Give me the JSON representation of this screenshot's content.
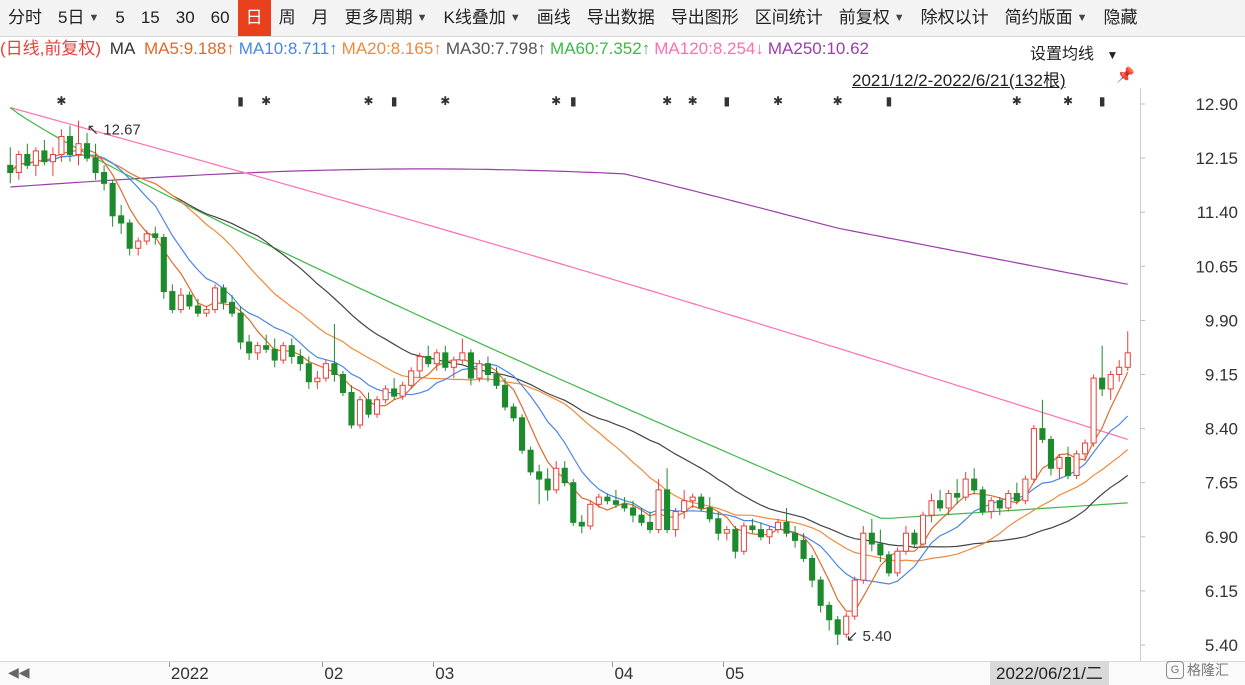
{
  "toolbar": {
    "items": [
      {
        "label": "分时",
        "active": false,
        "dropdown": false
      },
      {
        "label": "5日",
        "active": false,
        "dropdown": true
      },
      {
        "label": "5",
        "active": false,
        "dropdown": false
      },
      {
        "label": "15",
        "active": false,
        "dropdown": false
      },
      {
        "label": "30",
        "active": false,
        "dropdown": false
      },
      {
        "label": "60",
        "active": false,
        "dropdown": false
      },
      {
        "label": "日",
        "active": true,
        "dropdown": false
      },
      {
        "label": "周",
        "active": false,
        "dropdown": false
      },
      {
        "label": "月",
        "active": false,
        "dropdown": false
      },
      {
        "label": "更多周期",
        "active": false,
        "dropdown": true
      },
      {
        "label": "K线叠加",
        "active": false,
        "dropdown": true
      },
      {
        "label": "画线",
        "active": false,
        "dropdown": false
      },
      {
        "label": "导出数据",
        "active": false,
        "dropdown": false
      },
      {
        "label": "导出图形",
        "active": false,
        "dropdown": false
      },
      {
        "label": "区间统计",
        "active": false,
        "dropdown": false
      },
      {
        "label": "前复权",
        "active": false,
        "dropdown": true
      },
      {
        "label": "除权以计",
        "active": false,
        "dropdown": false
      },
      {
        "label": "简约版面",
        "active": false,
        "dropdown": true
      },
      {
        "label": "隐藏",
        "active": false,
        "dropdown": false
      }
    ]
  },
  "ma_legend": {
    "prefix": "(日线,前复权)",
    "ma_label": "MA",
    "items": [
      {
        "text": "MA5:9.188↑",
        "color": "#e06a2c"
      },
      {
        "text": "MA10:8.711↑",
        "color": "#4a86e8"
      },
      {
        "text": "MA20:8.165↑",
        "color": "#f08a3c"
      },
      {
        "text": "MA30:7.798↑",
        "color": "#555555"
      },
      {
        "text": "MA60:7.352↑",
        "color": "#3cb84a"
      },
      {
        "text": "MA120:8.254↓",
        "color": "#ff6eb4"
      },
      {
        "text": "MA250:10.62",
        "color": "#9b3fa8"
      }
    ],
    "settings_label": "设置均线",
    "range_label": "2021/12/2-2022/6/21(132根)"
  },
  "colors": {
    "up": "#e8403a",
    "down": "#1e8a2e",
    "ma5": "#e06a2c",
    "ma10": "#4a86e8",
    "ma20": "#f08a3c",
    "ma30": "#444444",
    "ma60": "#3cb84a",
    "ma120": "#ff6eb4",
    "ma250": "#9b3fa8"
  },
  "chart_data": {
    "type": "candlestick",
    "y_ticks": [
      "12.90",
      "12.15",
      "11.40",
      "10.65",
      "9.90",
      "9.15",
      "8.40",
      "7.65",
      "6.90",
      "6.15",
      "5.40"
    ],
    "ylim": [
      5.4,
      12.9
    ],
    "x_labels": [
      "2022",
      "02",
      "03",
      "04",
      "05"
    ],
    "annotations": [
      {
        "text": "12.67",
        "type": "high"
      },
      {
        "text": "5.40",
        "type": "low"
      }
    ],
    "current_date_label": "2022/06/21/二",
    "candles": [
      [
        12.05,
        12.3,
        11.8,
        11.95
      ],
      [
        11.95,
        12.25,
        11.85,
        12.2
      ],
      [
        12.2,
        12.35,
        12.0,
        12.05
      ],
      [
        12.05,
        12.3,
        11.9,
        12.25
      ],
      [
        12.25,
        12.4,
        12.05,
        12.1
      ],
      [
        12.1,
        12.3,
        11.9,
        12.2
      ],
      [
        12.2,
        12.55,
        12.1,
        12.45
      ],
      [
        12.45,
        12.6,
        12.1,
        12.2
      ],
      [
        12.2,
        12.67,
        12.05,
        12.35
      ],
      [
        12.35,
        12.5,
        12.1,
        12.15
      ],
      [
        12.15,
        12.35,
        11.85,
        11.95
      ],
      [
        11.95,
        12.05,
        11.7,
        11.8
      ],
      [
        11.8,
        11.85,
        11.2,
        11.35
      ],
      [
        11.35,
        11.5,
        11.1,
        11.25
      ],
      [
        11.25,
        11.3,
        10.8,
        10.9
      ],
      [
        10.9,
        11.05,
        10.8,
        11.0
      ],
      [
        11.0,
        11.15,
        10.95,
        11.1
      ],
      [
        11.1,
        11.2,
        10.95,
        11.05
      ],
      [
        11.05,
        11.1,
        10.2,
        10.3
      ],
      [
        10.3,
        10.4,
        10.0,
        10.05
      ],
      [
        10.05,
        10.35,
        10.0,
        10.25
      ],
      [
        10.25,
        10.3,
        10.05,
        10.1
      ],
      [
        10.1,
        10.2,
        9.95,
        10.0
      ],
      [
        10.0,
        10.1,
        9.95,
        10.05
      ],
      [
        10.05,
        10.4,
        10.0,
        10.35
      ],
      [
        10.35,
        10.4,
        10.05,
        10.15
      ],
      [
        10.15,
        10.25,
        9.95,
        10.0
      ],
      [
        10.0,
        10.1,
        9.5,
        9.6
      ],
      [
        9.6,
        9.7,
        9.35,
        9.45
      ],
      [
        9.45,
        9.6,
        9.35,
        9.55
      ],
      [
        9.55,
        9.7,
        9.45,
        9.5
      ],
      [
        9.5,
        9.65,
        9.25,
        9.35
      ],
      [
        9.35,
        9.6,
        9.3,
        9.55
      ],
      [
        9.55,
        9.65,
        9.3,
        9.4
      ],
      [
        9.4,
        9.5,
        9.2,
        9.3
      ],
      [
        9.3,
        9.4,
        8.95,
        9.05
      ],
      [
        9.05,
        9.2,
        8.95,
        9.1
      ],
      [
        9.1,
        9.35,
        9.05,
        9.3
      ],
      [
        9.3,
        9.85,
        9.05,
        9.15
      ],
      [
        9.15,
        9.2,
        8.85,
        8.9
      ],
      [
        8.9,
        9.0,
        8.4,
        8.45
      ],
      [
        8.45,
        8.85,
        8.4,
        8.8
      ],
      [
        8.8,
        8.9,
        8.55,
        8.6
      ],
      [
        8.6,
        8.85,
        8.55,
        8.8
      ],
      [
        8.8,
        9.0,
        8.75,
        8.95
      ],
      [
        8.95,
        9.1,
        8.8,
        8.85
      ],
      [
        8.85,
        9.05,
        8.8,
        9.0
      ],
      [
        9.0,
        9.25,
        8.95,
        9.2
      ],
      [
        9.2,
        9.45,
        9.1,
        9.4
      ],
      [
        9.4,
        9.55,
        9.25,
        9.3
      ],
      [
        9.3,
        9.5,
        9.2,
        9.45
      ],
      [
        9.45,
        9.55,
        9.2,
        9.25
      ],
      [
        9.25,
        9.4,
        9.1,
        9.35
      ],
      [
        9.35,
        9.65,
        9.3,
        9.45
      ],
      [
        9.45,
        9.5,
        9.0,
        9.1
      ],
      [
        9.1,
        9.35,
        9.05,
        9.3
      ],
      [
        9.3,
        9.4,
        9.05,
        9.15
      ],
      [
        9.15,
        9.25,
        8.95,
        9.0
      ],
      [
        9.0,
        9.1,
        8.65,
        8.7
      ],
      [
        8.7,
        8.75,
        8.5,
        8.55
      ],
      [
        8.55,
        8.6,
        8.05,
        8.1
      ],
      [
        8.1,
        8.15,
        7.75,
        7.8
      ],
      [
        7.8,
        7.9,
        7.35,
        7.7
      ],
      [
        7.7,
        7.85,
        7.4,
        7.55
      ],
      [
        7.55,
        7.95,
        7.5,
        7.85
      ],
      [
        7.85,
        7.95,
        7.6,
        7.65
      ],
      [
        7.65,
        7.7,
        7.05,
        7.1
      ],
      [
        7.1,
        7.2,
        6.95,
        7.05
      ],
      [
        7.05,
        7.4,
        7.0,
        7.35
      ],
      [
        7.35,
        7.5,
        7.3,
        7.45
      ],
      [
        7.45,
        7.5,
        7.35,
        7.4
      ],
      [
        7.4,
        7.55,
        7.3,
        7.35
      ],
      [
        7.35,
        7.45,
        7.25,
        7.3
      ],
      [
        7.3,
        7.4,
        7.1,
        7.2
      ],
      [
        7.2,
        7.3,
        7.05,
        7.1
      ],
      [
        7.1,
        7.25,
        6.95,
        7.0
      ],
      [
        7.0,
        7.7,
        6.95,
        7.55
      ],
      [
        7.55,
        7.85,
        6.95,
        7.0
      ],
      [
        7.0,
        7.3,
        6.9,
        7.25
      ],
      [
        7.25,
        7.55,
        7.15,
        7.4
      ],
      [
        7.4,
        7.5,
        7.3,
        7.45
      ],
      [
        7.45,
        7.5,
        7.25,
        7.3
      ],
      [
        7.3,
        7.45,
        7.1,
        7.15
      ],
      [
        7.15,
        7.25,
        6.85,
        6.95
      ],
      [
        6.95,
        7.05,
        6.85,
        7.0
      ],
      [
        7.0,
        7.05,
        6.6,
        6.7
      ],
      [
        6.7,
        7.1,
        6.65,
        7.05
      ],
      [
        7.05,
        7.15,
        6.95,
        7.0
      ],
      [
        7.0,
        7.1,
        6.85,
        6.9
      ],
      [
        6.9,
        7.05,
        6.8,
        7.0
      ],
      [
        7.0,
        7.15,
        6.95,
        7.1
      ],
      [
        7.1,
        7.3,
        6.9,
        6.95
      ],
      [
        6.95,
        7.05,
        6.75,
        6.85
      ],
      [
        6.85,
        6.95,
        6.55,
        6.6
      ],
      [
        6.6,
        6.65,
        6.2,
        6.3
      ],
      [
        6.3,
        6.35,
        5.85,
        5.95
      ],
      [
        5.95,
        6.0,
        5.6,
        5.75
      ],
      [
        5.75,
        5.8,
        5.4,
        5.55
      ],
      [
        5.55,
        5.85,
        5.5,
        5.8
      ],
      [
        5.8,
        6.35,
        5.75,
        6.3
      ],
      [
        6.3,
        7.05,
        6.25,
        6.95
      ],
      [
        6.95,
        7.15,
        6.7,
        6.8
      ],
      [
        6.8,
        7.0,
        6.55,
        6.65
      ],
      [
        6.65,
        6.7,
        6.35,
        6.4
      ],
      [
        6.4,
        6.75,
        6.35,
        6.7
      ],
      [
        6.7,
        7.05,
        6.65,
        6.95
      ],
      [
        6.95,
        7.0,
        6.75,
        6.8
      ],
      [
        6.8,
        7.25,
        6.75,
        7.2
      ],
      [
        7.2,
        7.5,
        7.1,
        7.4
      ],
      [
        7.4,
        7.55,
        7.25,
        7.3
      ],
      [
        7.3,
        7.55,
        7.2,
        7.5
      ],
      [
        7.5,
        7.7,
        7.35,
        7.45
      ],
      [
        7.45,
        7.8,
        7.4,
        7.7
      ],
      [
        7.7,
        7.85,
        7.5,
        7.55
      ],
      [
        7.55,
        7.6,
        7.2,
        7.25
      ],
      [
        7.25,
        7.45,
        7.15,
        7.4
      ],
      [
        7.4,
        7.45,
        7.2,
        7.3
      ],
      [
        7.3,
        7.55,
        7.25,
        7.5
      ],
      [
        7.5,
        7.65,
        7.35,
        7.4
      ],
      [
        7.4,
        7.75,
        7.35,
        7.7
      ],
      [
        7.7,
        8.45,
        7.65,
        8.4
      ],
      [
        8.4,
        8.8,
        8.2,
        8.25
      ],
      [
        8.25,
        8.3,
        7.75,
        7.85
      ],
      [
        7.85,
        8.05,
        7.7,
        8.0
      ],
      [
        8.0,
        8.15,
        7.7,
        7.75
      ],
      [
        7.75,
        8.1,
        7.7,
        8.05
      ],
      [
        8.05,
        8.25,
        7.95,
        8.2
      ],
      [
        8.2,
        9.15,
        8.15,
        9.1
      ],
      [
        9.1,
        9.55,
        8.85,
        8.95
      ],
      [
        8.95,
        9.2,
        8.8,
        9.15
      ],
      [
        9.15,
        9.35,
        9.05,
        9.25
      ],
      [
        9.25,
        9.75,
        9.2,
        9.45
      ]
    ]
  }
}
